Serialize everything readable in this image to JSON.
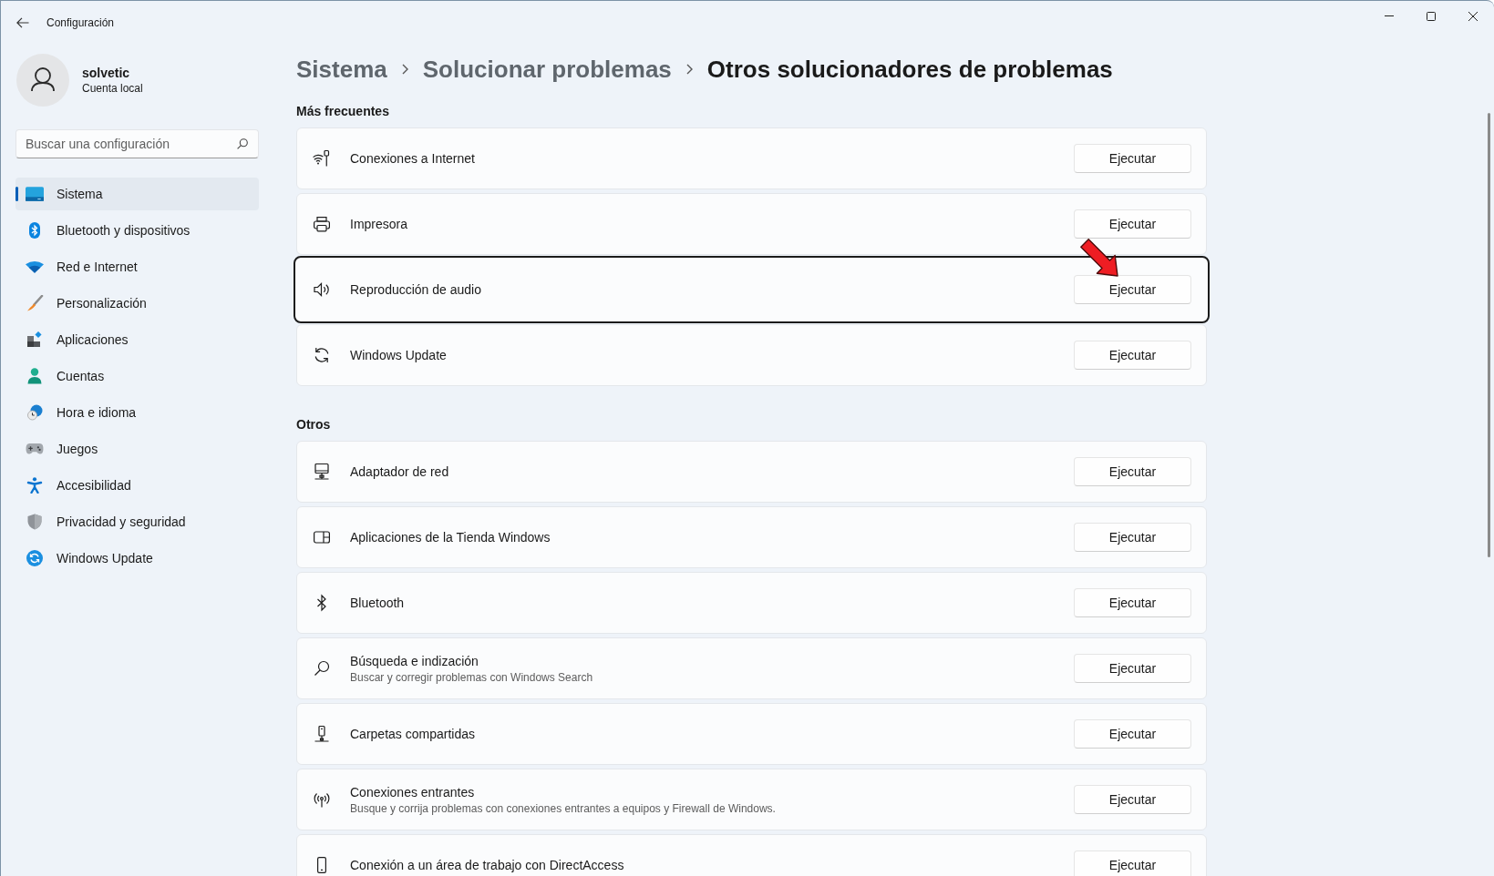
{
  "window": {
    "title": "Configuración"
  },
  "profile": {
    "name": "solvetic",
    "account_type": "Cuenta local"
  },
  "search": {
    "placeholder": "Buscar una configuración"
  },
  "sidebar": {
    "items": [
      {
        "label": "Sistema",
        "selected": true
      },
      {
        "label": "Bluetooth y dispositivos",
        "selected": false
      },
      {
        "label": "Red e Internet",
        "selected": false
      },
      {
        "label": "Personalización",
        "selected": false
      },
      {
        "label": "Aplicaciones",
        "selected": false
      },
      {
        "label": "Cuentas",
        "selected": false
      },
      {
        "label": "Hora e idioma",
        "selected": false
      },
      {
        "label": "Juegos",
        "selected": false
      },
      {
        "label": "Accesibilidad",
        "selected": false
      },
      {
        "label": "Privacidad y seguridad",
        "selected": false
      },
      {
        "label": "Windows Update",
        "selected": false
      }
    ]
  },
  "breadcrumb": [
    {
      "label": "Sistema",
      "current": false
    },
    {
      "label": "Solucionar problemas",
      "current": false
    },
    {
      "label": "Otros solucionadores de problemas",
      "current": true
    }
  ],
  "sections": [
    {
      "title": "Más frecuentes",
      "items": [
        {
          "title": "Conexiones a Internet",
          "button": "Ejecutar",
          "highlighted": false
        },
        {
          "title": "Impresora",
          "button": "Ejecutar",
          "highlighted": false
        },
        {
          "title": "Reproducción de audio",
          "button": "Ejecutar",
          "highlighted": true
        },
        {
          "title": "Windows Update",
          "button": "Ejecutar",
          "highlighted": false
        }
      ]
    },
    {
      "title": "Otros",
      "items": [
        {
          "title": "Adaptador de red",
          "button": "Ejecutar",
          "highlighted": false
        },
        {
          "title": "Aplicaciones de la Tienda Windows",
          "button": "Ejecutar",
          "highlighted": false
        },
        {
          "title": "Bluetooth",
          "button": "Ejecutar",
          "highlighted": false
        },
        {
          "title": "Búsqueda e indización",
          "description": "Buscar y corregir problemas con Windows Search",
          "button": "Ejecutar",
          "highlighted": false
        },
        {
          "title": "Carpetas compartidas",
          "button": "Ejecutar",
          "highlighted": false
        },
        {
          "title": "Conexiones entrantes",
          "description": "Busque y corrija problemas con conexiones entrantes a equipos y Firewall de Windows.",
          "button": "Ejecutar",
          "highlighted": false
        },
        {
          "title": "Conexión a un área de trabajo con DirectAccess",
          "button": "Ejecutar",
          "highlighted": false
        }
      ]
    }
  ]
}
